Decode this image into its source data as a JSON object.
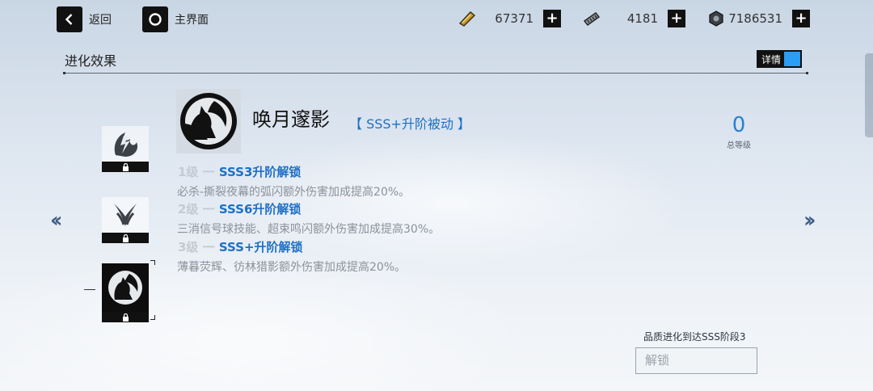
{
  "nav": {
    "back_label": "返回",
    "home_label": "主界面"
  },
  "resources": [
    {
      "icon": "gold-bar-icon",
      "value": "67371"
    },
    {
      "icon": "ammo-clip-icon",
      "value": "4181"
    },
    {
      "icon": "gear-nut-icon",
      "value": "7186531"
    }
  ],
  "section": {
    "title": "进化效果",
    "detail_toggle_label": "详情"
  },
  "skill": {
    "name": "唤月邃影",
    "tag": "【 SSS+升阶被动 】"
  },
  "level": {
    "value": "0",
    "caption": "总等级"
  },
  "tiers": [
    {
      "level_label": "1级 一 ",
      "name": "SSS3升阶解锁",
      "description": "必杀-撕裂夜幕的弧闪额外伤害加成提高20%。"
    },
    {
      "level_label": "2级 一 ",
      "name": "SSS6升阶解锁",
      "description": "三消信号球技能、超束鸣闪额外伤害加成提高30%。"
    },
    {
      "level_label": "3级 一 ",
      "name": "SSS+升阶解锁",
      "description": "薄暮荧辉、彷林猎影额外伤害加成提高20%。"
    }
  ],
  "unlock": {
    "condition": "品质进化到达SSS阶段3",
    "button_label": "解锁"
  },
  "colors": {
    "accent": "#1e6fc6",
    "toggle_knob": "#2a9df4"
  }
}
